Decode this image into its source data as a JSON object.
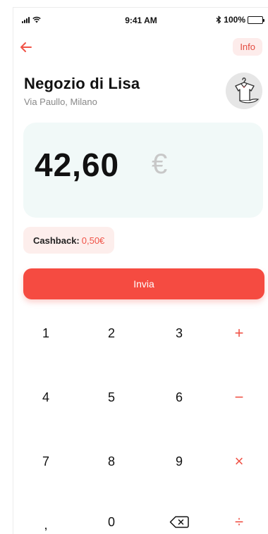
{
  "status_bar": {
    "time": "9:41 AM",
    "battery": "100%",
    "icons": [
      "signal-icon",
      "wifi-icon",
      "bluetooth-icon",
      "battery-icon"
    ]
  },
  "header": {
    "back_icon": "arrow-left-icon",
    "info_label": "Info"
  },
  "store": {
    "name": "Negozio di Lisa",
    "address": "Via Paullo, Milano",
    "logo_icon": "shirt-on-hanger-icon"
  },
  "amount": {
    "value": "42,60",
    "currency": "€"
  },
  "cashback": {
    "label": "Cashback:",
    "value": "0,50€"
  },
  "send_label": "Invia",
  "keypad": {
    "k1": "1",
    "k2": "2",
    "k3": "3",
    "plus": "+",
    "k4": "4",
    "k5": "5",
    "k6": "6",
    "minus": "−",
    "k7": "7",
    "k8": "8",
    "k9": "9",
    "times": "×",
    "comma": ",",
    "k0": "0",
    "backspace_icon": "backspace-icon",
    "divide": "÷"
  },
  "colors": {
    "accent": "#f54b41",
    "accent_soft": "#fdeceb",
    "amount_card_bg": "#f1f9f8",
    "currency_gray": "#c8c8c8"
  }
}
